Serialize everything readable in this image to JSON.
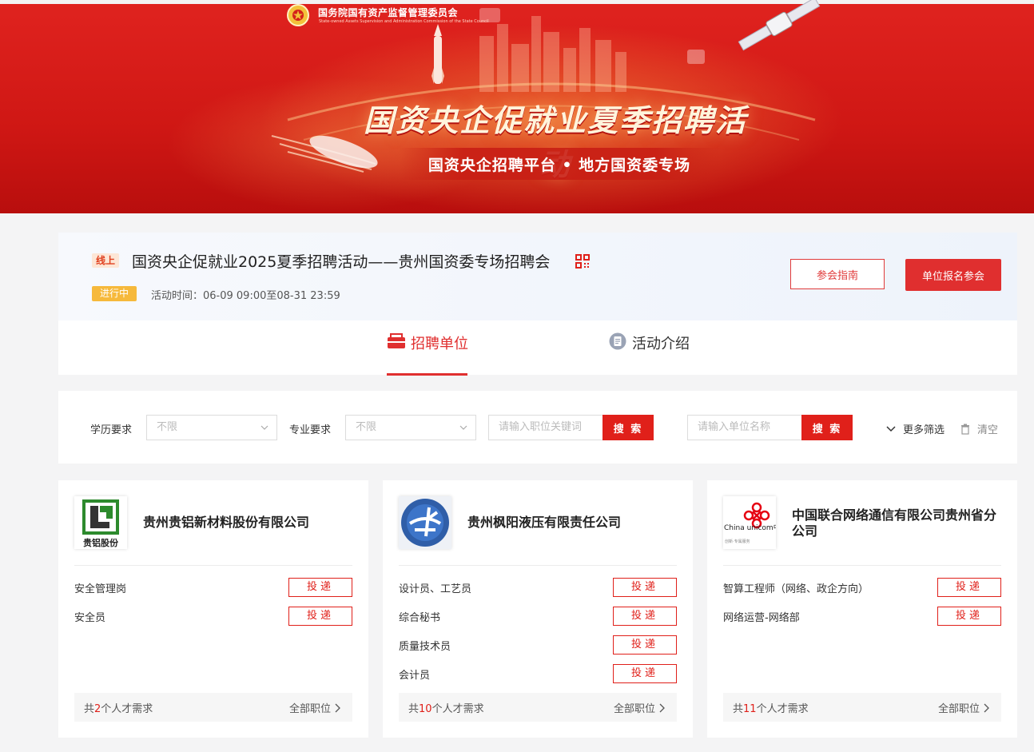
{
  "banner": {
    "org_name": "国务院国有资产监督管理委员会",
    "org_name_en": "State-owned Assets Supervision and Administration Commission of the State Council",
    "title": "国资央企促就业夏季招聘活动",
    "subtitle": "国资央企招聘平台 • 地方国资委专场"
  },
  "activity": {
    "mode_tag": "线上",
    "title": "国资央企促就业2025夏季招聘活动——贵州国资委专场招聘会",
    "status": "进行中",
    "time_label": "活动时间：06-09 09:00至08-31 23:59",
    "guide_button": "参会指南",
    "join_button": "单位报名参会"
  },
  "tabs": [
    {
      "label": "招聘单位",
      "icon": "briefcase-icon",
      "active": true
    },
    {
      "label": "活动介绍",
      "icon": "document-icon",
      "active": false
    }
  ],
  "filters": {
    "education_label": "学历要求",
    "education_value": "不限",
    "major_label": "专业要求",
    "major_value": "不限",
    "job_search_placeholder": "请输入职位关键词",
    "job_search_button": "搜 索",
    "company_search_placeholder": "请输入单位名称",
    "company_search_button": "搜 索",
    "more_filters": "更多筛选",
    "clear": "清空"
  },
  "companies": [
    {
      "name": "贵州贵铝新材料股份有限公司",
      "logo_text": "贵铝股份",
      "jobs": [
        "安全管理岗",
        "安全员"
      ],
      "count_prefix": "共",
      "count": "2",
      "count_suffix": "个人才需求",
      "all_jobs": "全部职位"
    },
    {
      "name": "贵州枫阳液压有限责任公司",
      "logo_text": "",
      "jobs": [
        "设计员、工艺员",
        "综合秘书",
        "质量技术员",
        "会计员"
      ],
      "count_prefix": "共",
      "count": "10",
      "count_suffix": "个人才需求",
      "all_jobs": "全部职位"
    },
    {
      "name": "中国联合网络通信有限公司贵州省分公司",
      "logo_text": "China unicom中国联通",
      "jobs": [
        "智算工程师（网络、政企方向）",
        "网络运营-网络部"
      ],
      "count_prefix": "共",
      "count": "11",
      "count_suffix": "个人才需求",
      "all_jobs": "全部职位"
    }
  ],
  "apply_label": "投递",
  "colors": {
    "brand_red": "#e0201a",
    "status_orange": "#f6b93b"
  }
}
